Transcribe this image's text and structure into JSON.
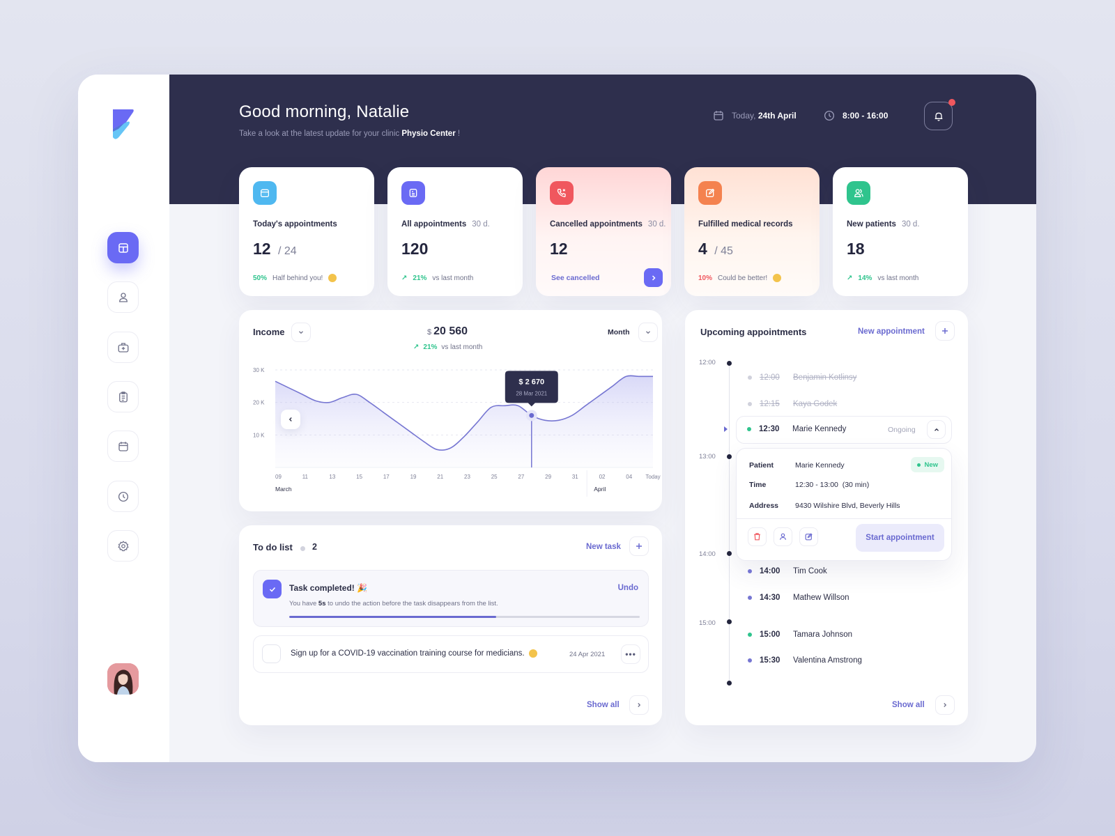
{
  "sidebar": {
    "logo": "app-logo",
    "items": [
      {
        "id": "dashboard",
        "icon": "layout-icon",
        "active": true
      },
      {
        "id": "patients",
        "icon": "user-icon",
        "active": false
      },
      {
        "id": "medical",
        "icon": "medical-kit-icon",
        "active": false
      },
      {
        "id": "records",
        "icon": "clipboard-icon",
        "active": false
      },
      {
        "id": "calendar",
        "icon": "calendar-icon",
        "active": false
      },
      {
        "id": "history",
        "icon": "clock-icon",
        "active": false
      },
      {
        "id": "settings",
        "icon": "gear-icon",
        "active": false
      }
    ],
    "avatar": "user-avatar"
  },
  "header": {
    "greeting": "Good morning, Natalie",
    "subtitle_prefix": "Take a look at the latest update for your clinic",
    "clinic_name": "Physio Center",
    "subtitle_suffix": " !",
    "date_prefix": "Today,",
    "date": "24th April",
    "hours": "8:00 - 16:00",
    "has_notification": true
  },
  "stats": [
    {
      "title": "Today's appointments",
      "period": "",
      "value": "12",
      "of": "/ 24",
      "pct": "50%",
      "note": "Half behind you!",
      "color": "#4fb8f0"
    },
    {
      "title": "All appointments",
      "period": "30 d.",
      "value": "120",
      "of": "",
      "pct": "21%",
      "note": "vs last month",
      "color": "#6a6af4"
    },
    {
      "title": "Cancelled appointments",
      "period": "30 d.",
      "value": "12",
      "of": "",
      "link": "See cancelled",
      "color": "#f0575e"
    },
    {
      "title": "Fulfilled medical records",
      "period": "",
      "value": "4",
      "of": "/ 45",
      "pct": "10%",
      "note": "Could be better!",
      "color": "#f4824f"
    },
    {
      "title": "New patients",
      "period": "30 d.",
      "value": "18",
      "of": "",
      "pct": "14%",
      "note": "vs last month",
      "color": "#2fc48d"
    }
  ],
  "income": {
    "title": "Income",
    "currency": "$",
    "total": "20 560",
    "change_pct": "21%",
    "change_label": "vs last month",
    "period": "Month",
    "tooltip": {
      "value": "2 670",
      "currency": "$",
      "date": "28 Mar 2021"
    }
  },
  "chart_data": {
    "type": "area",
    "title": "Income",
    "xlabel": "",
    "ylabel": "",
    "ylim": [
      0,
      30000
    ],
    "y_ticks": [
      "10 K",
      "20 K",
      "30 K"
    ],
    "y_tick_values": [
      10000,
      20000,
      30000
    ],
    "x_ticks": [
      "09",
      "11",
      "13",
      "15",
      "17",
      "19",
      "21",
      "23",
      "25",
      "27",
      "29",
      "31",
      "02",
      "04",
      "Today"
    ],
    "month_labels": [
      "March",
      "April"
    ],
    "x": [
      "09",
      "10",
      "11",
      "12",
      "13",
      "14",
      "15",
      "16",
      "17",
      "18",
      "19",
      "20",
      "21",
      "22",
      "23",
      "24",
      "25",
      "26",
      "27",
      "28",
      "29",
      "30",
      "31",
      "01",
      "02",
      "03",
      "04",
      "05",
      "Today"
    ],
    "series": [
      {
        "name": "Income",
        "values": [
          26500,
          24500,
          22500,
          20500,
          20000,
          21500,
          22500,
          20000,
          17000,
          14000,
          11000,
          8000,
          5500,
          6000,
          9500,
          14000,
          18500,
          19000,
          19000,
          16000,
          14500,
          14500,
          16000,
          19000,
          22000,
          25000,
          28000,
          28000,
          28000
        ]
      }
    ],
    "highlight": {
      "x": "28",
      "label": "$ 2 670",
      "date": "28 Mar 2021"
    },
    "grid": true
  },
  "todo": {
    "title": "To do list",
    "count": "2",
    "new_label": "New task",
    "completed": {
      "title": "Task completed!",
      "desc_prefix": "You have",
      "desc_bold": "5s",
      "desc_suffix": "to undo the action before the task disappears from the list.",
      "undo_label": "Undo",
      "progress": 0.59
    },
    "items": [
      {
        "text": "Sign up for a COVID-19 vaccination training course for medicians.",
        "date": "24 Apr 2021",
        "done": false
      }
    ],
    "show_all": "Show all"
  },
  "upcoming": {
    "title": "Upcoming appointments",
    "new_label": "New appointment",
    "hours": [
      "12:00",
      "13:00",
      "14:00",
      "15:00"
    ],
    "appointments": [
      {
        "time": "12:00",
        "name": "Benjamin Kotlinsy",
        "state": "past"
      },
      {
        "time": "12:15",
        "name": "Kaya Godek",
        "state": "past"
      },
      {
        "time": "12:30",
        "name": "Marie Kennedy",
        "state": "ongoing",
        "status": "Ongoing"
      },
      {
        "time": "14:00",
        "name": "Tim Cook",
        "state": "upcoming"
      },
      {
        "time": "14:30",
        "name": "Mathew Willson",
        "state": "upcoming"
      },
      {
        "time": "15:00",
        "name": "Tamara Johnson",
        "state": "new"
      },
      {
        "time": "15:30",
        "name": "Valentina Amstrong",
        "state": "upcoming"
      }
    ],
    "detail": {
      "patient_label": "Patient",
      "patient": "Marie Kennedy",
      "time_label": "Time",
      "time": "12:30 - 13:00  (30 min)",
      "address_label": "Address",
      "address": "9430 Wilshire Blvd, Beverly Hills",
      "badge": "New",
      "start_label": "Start appointment"
    },
    "show_all": "Show all"
  },
  "colors": {
    "accent": "#6a6af4",
    "navy": "#2e2f4d",
    "green": "#2fc48d",
    "red": "#f0575e",
    "orange": "#f4824f",
    "blue": "#4fb8f0"
  }
}
